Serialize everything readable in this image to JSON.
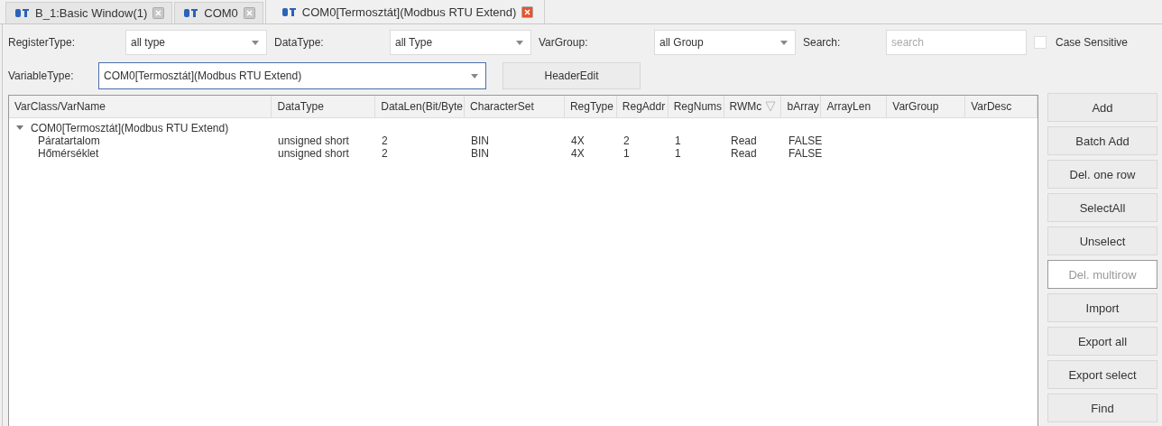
{
  "tabs": [
    {
      "label": "B_1:Basic Window(1)",
      "selected": false
    },
    {
      "label": "COM0",
      "selected": false
    },
    {
      "label": "COM0[Termosztát](Modbus RTU Extend)",
      "selected": true
    }
  ],
  "filters": {
    "register_type": {
      "label": "RegisterType:",
      "value": "all type"
    },
    "data_type": {
      "label": "DataType:",
      "value": "all Type"
    },
    "var_group": {
      "label": "VarGroup:",
      "value": "all Group"
    },
    "search": {
      "label": "Search:",
      "placeholder": "search"
    },
    "case_sensitive": {
      "label": "Case Sensitive",
      "checked": false
    },
    "variable_type": {
      "label": "VariableType:",
      "value": "COM0[Termosztát](Modbus RTU Extend)"
    },
    "header_edit": "HeaderEdit"
  },
  "table": {
    "columns": [
      {
        "label": "VarClass/VarName"
      },
      {
        "label": "DataType"
      },
      {
        "label": "DataLen(Bit/Byte"
      },
      {
        "label": "CharacterSet"
      },
      {
        "label": "RegType"
      },
      {
        "label": "RegAddr"
      },
      {
        "label": "RegNums"
      },
      {
        "label": "RWMc",
        "filter": true
      },
      {
        "label": "bArray"
      },
      {
        "label": "ArrayLen"
      },
      {
        "label": "VarGroup"
      },
      {
        "label": "VarDesc"
      }
    ],
    "groups": [
      {
        "name": "COM0[Termosztát](Modbus RTU Extend)",
        "expanded": true,
        "children": [
          {
            "cells": [
              "Páratartalom",
              "unsigned short",
              "2",
              "BIN",
              "4X",
              "2",
              "1",
              "Read",
              "FALSE"
            ]
          },
          {
            "cells": [
              "Hőmérséklet",
              "unsigned short",
              "2",
              "BIN",
              "4X",
              "1",
              "1",
              "Read",
              "FALSE"
            ]
          }
        ]
      }
    ]
  },
  "buttons": [
    {
      "label": "Add",
      "disabled": false
    },
    {
      "label": "Batch Add",
      "disabled": false
    },
    {
      "label": "Del. one row",
      "disabled": false
    },
    {
      "label": "SelectAll",
      "disabled": false
    },
    {
      "label": "Unselect",
      "disabled": false
    },
    {
      "label": "Del. multirow",
      "disabled": true
    },
    {
      "label": "Import",
      "disabled": false
    },
    {
      "label": "Export all",
      "disabled": false
    },
    {
      "label": "Export select",
      "disabled": false
    },
    {
      "label": "Find",
      "disabled": false
    }
  ]
}
